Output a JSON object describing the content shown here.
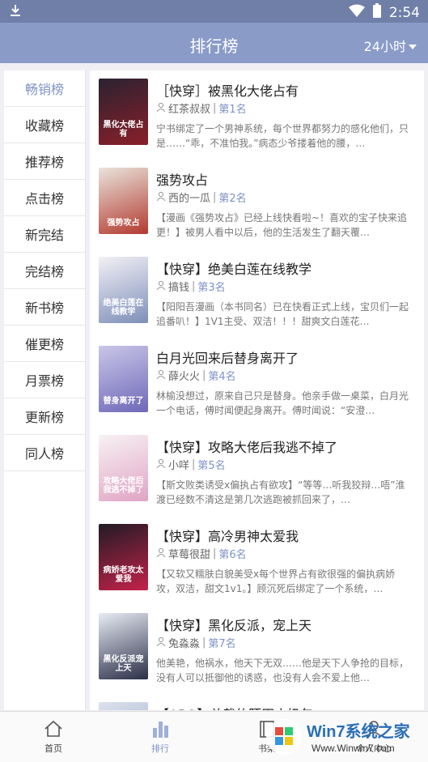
{
  "status_bar": {
    "time": "2:54"
  },
  "header": {
    "title": "排行榜",
    "range": "24小时"
  },
  "sidebar": {
    "items": [
      "畅销榜",
      "收藏榜",
      "推荐榜",
      "点击榜",
      "新完结",
      "完结榜",
      "新书榜",
      "催更榜",
      "月票榜",
      "更新榜",
      "同人榜"
    ],
    "active_index": 0
  },
  "books": [
    {
      "title": "［快穿］被黑化大佬占有",
      "author": "红茶叔叔",
      "rank": "第1名",
      "desc": "宁书绑定了一个男神系统，每个世界都努力的感化他们，只是……“乖，不准怕我。”病态少爷搂着他的腰，…",
      "cover_text": "黑化大佬占有",
      "cover_colors": [
        "#2b2230",
        "#8a1f2a"
      ]
    },
    {
      "title": "强势攻占",
      "author": "西的一瓜",
      "rank": "第2名",
      "desc": "【漫画《强势攻占》已经上线快看啦~！喜欢的宝子快来追更！】被男人看中以后，他的生活发生了翻天覆…",
      "cover_text": "强势攻占",
      "cover_colors": [
        "#e9e4dc",
        "#b33a2f"
      ]
    },
    {
      "title": "【快穿】绝美白莲在线教学",
      "author": "搞钱",
      "rank": "第3名",
      "desc": "【阳阳吾漫画（本书同名）已在快看正式上线，宝贝们一起追番叭！】1V1主受、双洁！！！甜爽文白莲花…",
      "cover_text": "绝美白莲在线教学",
      "cover_colors": [
        "#f3f0f6",
        "#7d8fb8"
      ]
    },
    {
      "title": "白月光回来后替身离开了",
      "author": "薛火火",
      "rank": "第4名",
      "desc": "林榆没想过，原来自己只是替身。他亲手做一桌菜，白月光一个电话，傅时闻便起身离开。傅时闻说：“安澄…",
      "cover_text": "替身离开了",
      "cover_colors": [
        "#c9c6e8",
        "#6f68b8"
      ]
    },
    {
      "title": "【快穿】攻略大佬后我逃不掉了",
      "author": "小咩",
      "rank": "第5名",
      "desc": "【斯文败类诱受x偏执占有欲攻】“等等…听我狡辩…唔”淮渡已经数不清这是第几次逃跑被抓回来了，…",
      "cover_text": "攻略大佬后我逃不掉了",
      "cover_colors": [
        "#f7f2f4",
        "#e0a4c4"
      ]
    },
    {
      "title": "【快穿】高冷男神太爱我",
      "author": "草莓很甜",
      "rank": "第6名",
      "desc": "【又软又糯肤白貌美受x每个世界占有欲很强的偏执病娇攻，双洁，甜文1v1。】顾沉死后绑定了一个系统，…",
      "cover_text": "病娇老攻太爱我",
      "cover_colors": [
        "#221b25",
        "#c4224a"
      ]
    },
    {
      "title": "【快穿】黑化反派，宠上天",
      "author": "兔淼淼",
      "rank": "第7名",
      "desc": "他美艳，他祸水，他天下无双……他是天下人争抢的目标，没有人可以抵御他的诱惑，也没有人会不爱上他…",
      "cover_text": "黑化反派宠上天",
      "cover_colors": [
        "#e8ecf4",
        "#2a2f48"
      ]
    },
    {
      "title": "【ABO】总裁的陌田小奶包",
      "cover_colors": [
        "#dde2ec",
        "#8a9bc8"
      ]
    }
  ],
  "tabbar": {
    "items": [
      "首页",
      "排行",
      "书架",
      "个人中心"
    ],
    "active_index": 1
  },
  "watermark": {
    "brand_main": "Win7系统之家",
    "brand_sub": "Www.Winwin7.com"
  },
  "colors": {
    "accent": "#7f93c6",
    "header": "#8a9bc8",
    "status": "#6f7fa7"
  }
}
